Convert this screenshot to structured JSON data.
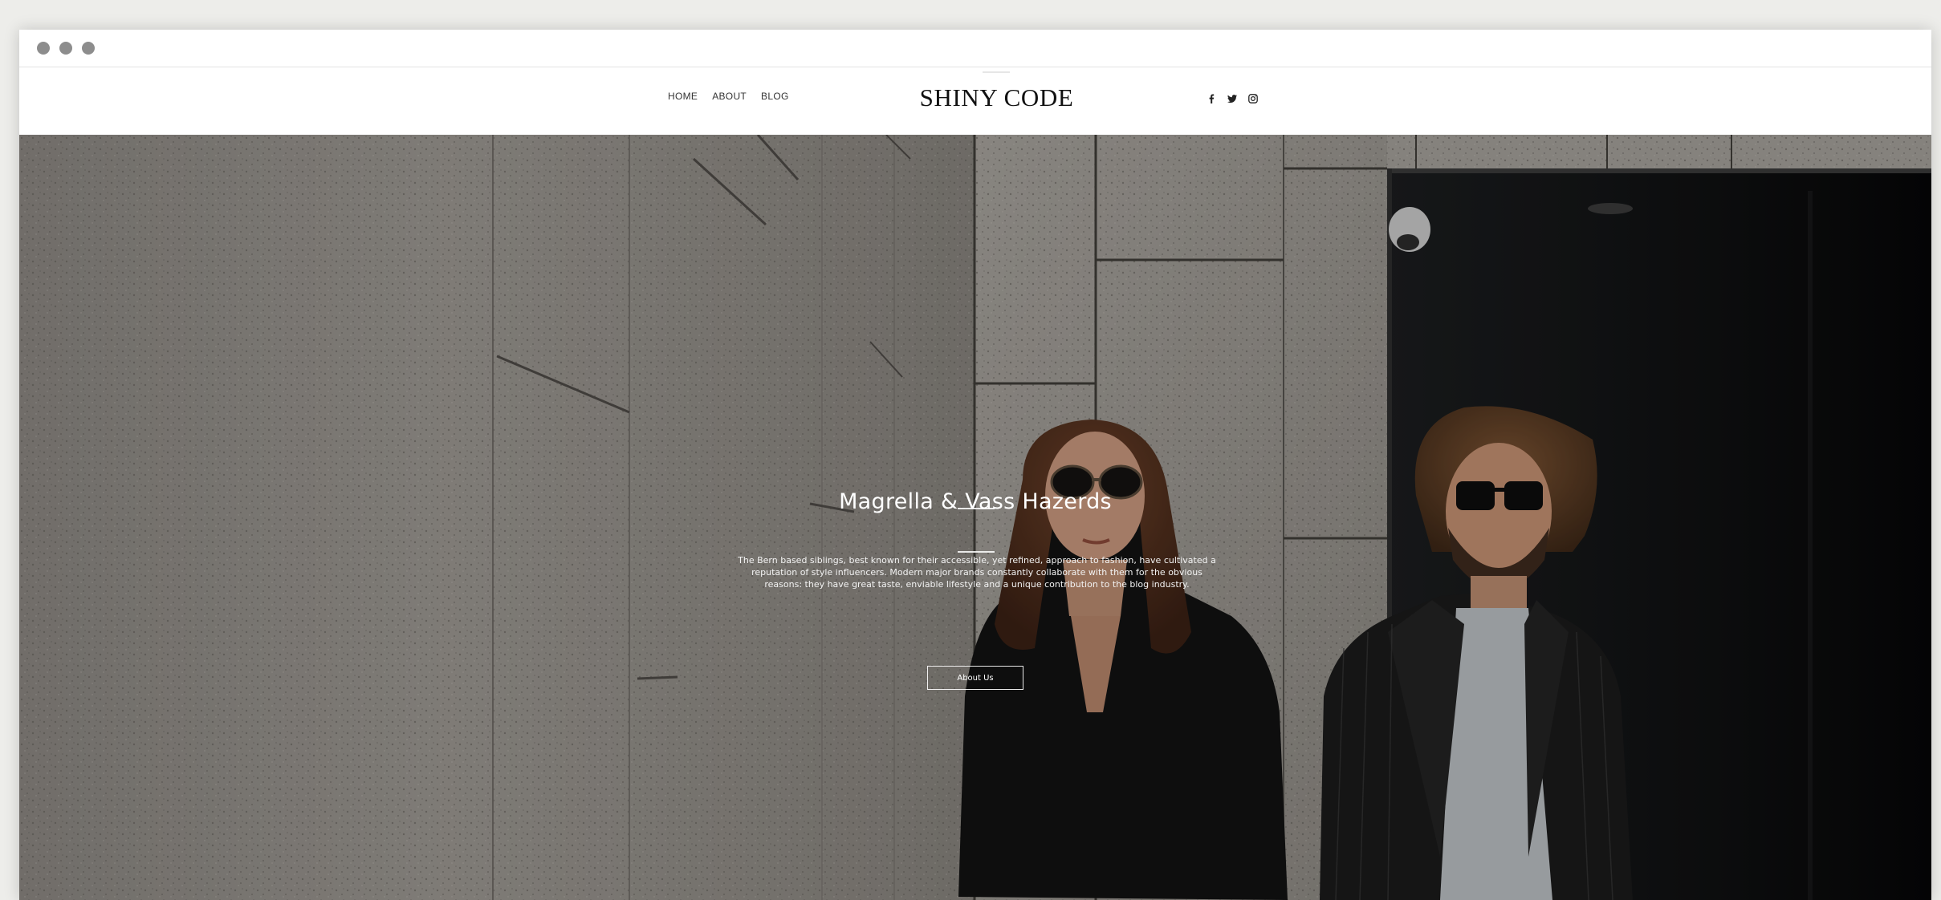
{
  "window": {
    "controls": [
      "window-dot",
      "window-dot",
      "window-dot"
    ]
  },
  "header": {
    "nav": [
      {
        "label": "HOME"
      },
      {
        "label": "ABOUT"
      },
      {
        "label": "BLOG"
      }
    ],
    "logo": "SHINY CODE",
    "social": [
      "facebook-icon",
      "twitter-icon",
      "instagram-icon"
    ]
  },
  "hero": {
    "title": "Magrella & Vass Hazerds",
    "description": "The Bern based siblings, best known for their accessible, yet refined, approach to fashion, have cultivated a reputation of style influencers. Modern major brands constantly collaborate with them for the obvious reasons: they have great taste, enviable lifestyle and a unique contribution to the blog industry.",
    "button_label": "About Us"
  },
  "colors": {
    "background": "#ededea",
    "header_bg": "#ffffff",
    "text_dark": "#111111",
    "hero_overlay": "#000000"
  }
}
